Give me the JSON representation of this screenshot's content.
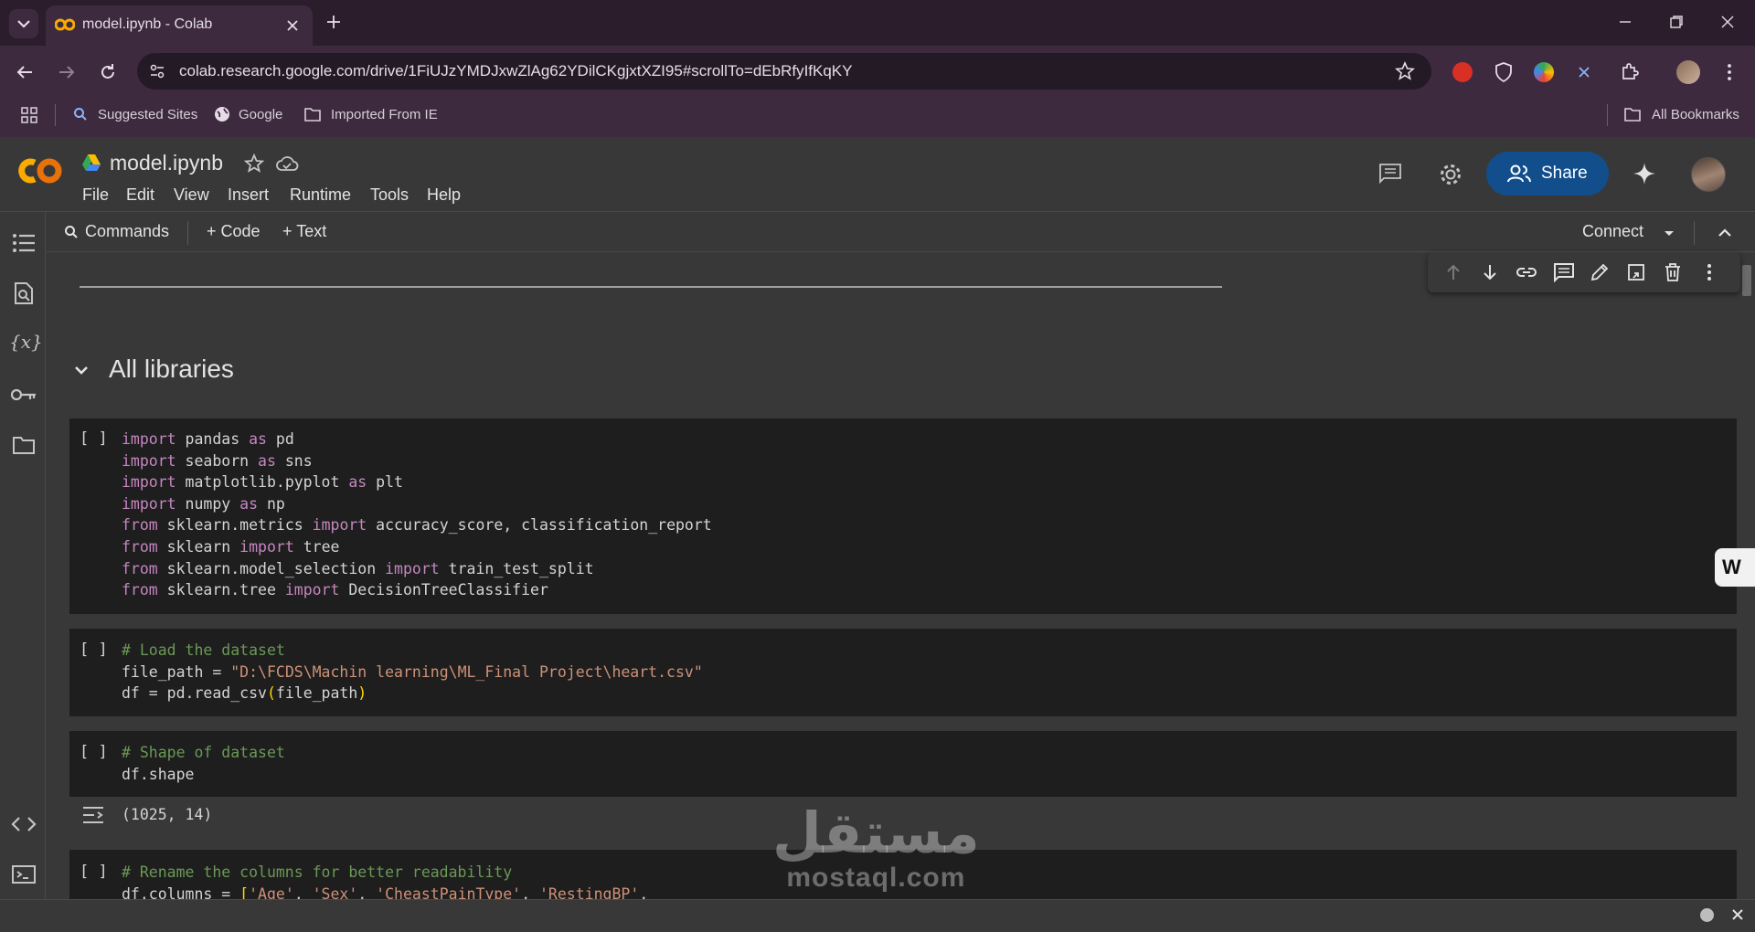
{
  "browser": {
    "tab_title": "model.ipynb - Colab",
    "url": "colab.research.google.com/drive/1FiUJzYMDJxwZlAg62YDilCKgjxtXZI95#scrollTo=dEbRfyIfKqKY",
    "bookmarks": [
      "Suggested Sites",
      "Google",
      "Imported From IE"
    ],
    "all_bookmarks": "All Bookmarks"
  },
  "colab": {
    "logo": "CO",
    "notebook_title": "model.ipynb",
    "menu": [
      "File",
      "Edit",
      "View",
      "Insert",
      "Runtime",
      "Tools",
      "Help"
    ],
    "share_label": "Share",
    "commands_label": "Commands",
    "add_code_label": "+ Code",
    "add_text_label": "+ Text",
    "connect_label": "Connect"
  },
  "notebook": {
    "section_heading": "All libraries",
    "cell_marker": "[ ]",
    "cells": [
      {
        "lines": [
          "import pandas as pd",
          "import seaborn as sns",
          "import matplotlib.pyplot as plt",
          "import numpy as np",
          "from sklearn.metrics import accuracy_score, classification_report",
          "from sklearn import tree",
          "from sklearn.model_selection import train_test_split",
          "from sklearn.tree import DecisionTreeClassifier"
        ]
      },
      {
        "lines": [
          "# Load the dataset",
          "file_path = \"D:\\FCDS\\Machin learning\\ML_Final Project\\heart.csv\"",
          "df = pd.read_csv(file_path)"
        ]
      },
      {
        "lines": [
          "# Shape of dataset",
          "df.shape"
        ],
        "output": "(1025, 14)"
      },
      {
        "lines": [
          "# Rename the columns for better readability",
          "df.columns = ['Age', 'Sex', 'CheastPainType', 'RestingBP',"
        ]
      }
    ]
  },
  "watermark": {
    "arabic": "مستقل",
    "latin": "mostaql.com"
  },
  "colors": {
    "tabstrip": "#2b1d2c",
    "toolbar": "#3d2a3f",
    "colab_bg": "#383838",
    "cell_bg": "#1e1e1e",
    "share_button": "#124e8c",
    "keyword": "#c586c0",
    "comment": "#6a9955",
    "string": "#ce9178"
  }
}
